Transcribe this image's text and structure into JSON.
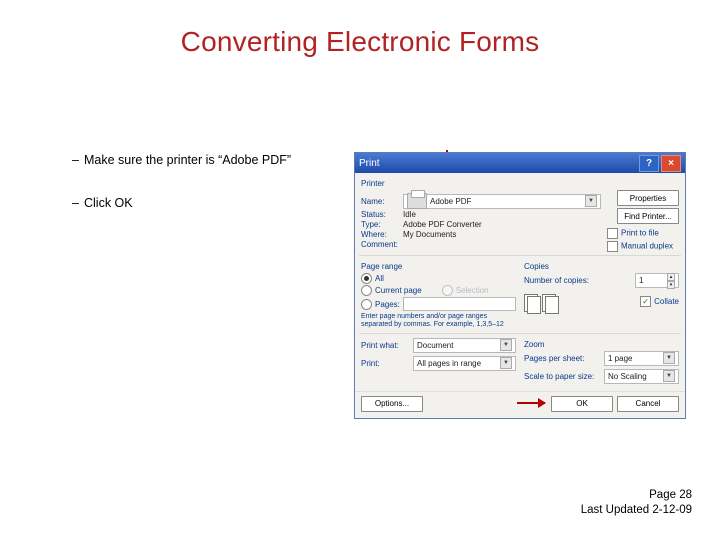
{
  "title": "Converting Electronic Forms",
  "bullets": [
    "Make sure the printer is “Adobe PDF”",
    "Click OK"
  ],
  "dialog": {
    "title": "Print",
    "help": "?",
    "close": "×",
    "printer": {
      "section": "Printer",
      "name_label": "Name:",
      "name_value": "Adobe PDF",
      "status_label": "Status:",
      "status_value": "Idle",
      "type_label": "Type:",
      "type_value": "Adobe PDF Converter",
      "where_label": "Where:",
      "where_value": "My Documents",
      "comment_label": "Comment:",
      "comment_value": "",
      "properties": "Properties",
      "find_printer": "Find Printer...",
      "print_to_file": "Print to file",
      "manual_duplex": "Manual duplex"
    },
    "page_range": {
      "section": "Page range",
      "all": "All",
      "current": "Current page",
      "selection": "Selection",
      "pages": "Pages:",
      "hint": "Enter page numbers and/or page ranges separated by commas. For example, 1,3,5–12"
    },
    "copies": {
      "section": "Copies",
      "num_label": "Number of copies:",
      "num_value": "1",
      "collate": "Collate"
    },
    "print_what": {
      "label": "Print what:",
      "value": "Document"
    },
    "print": {
      "label": "Print:",
      "value": "All pages in range"
    },
    "zoom": {
      "section": "Zoom",
      "pps_label": "Pages per sheet:",
      "pps_value": "1 page",
      "scale_label": "Scale to paper size:",
      "scale_value": "No Scaling"
    },
    "options": "Options...",
    "ok": "OK",
    "cancel": "Cancel"
  },
  "footer": {
    "page": "Page 28",
    "updated": "Last Updated 2-12-09"
  }
}
